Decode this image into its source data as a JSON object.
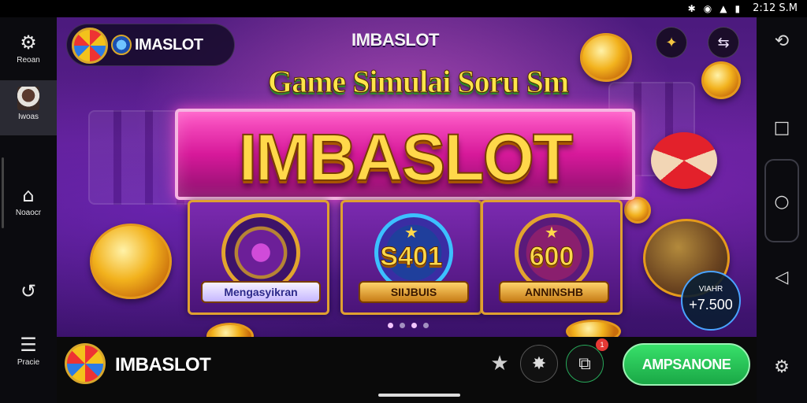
{
  "status_bar": {
    "icons": [
      "bluetooth-icon",
      "wifi-icon",
      "signal-icon",
      "battery-icon"
    ],
    "time": "2:12 S.M"
  },
  "left_rail": {
    "items": [
      {
        "label": "Reoan",
        "icon": "gear-icon"
      },
      {
        "label": "Iwoas",
        "icon": "avatar"
      },
      {
        "label": "Noaocr",
        "icon": "home-icon"
      },
      {
        "label": "",
        "icon": "undo-icon"
      },
      {
        "label": "Pracie",
        "icon": "layers-icon"
      }
    ]
  },
  "right_rail": {
    "icons": [
      "rotate-icon",
      "square-icon",
      "circle-home-icon",
      "back-triangle-icon",
      "settings-gear-icon"
    ]
  },
  "game": {
    "logo_text": "IMASLOT",
    "top_brand": "IMBASLOT",
    "subtitle": "Game Simulai Soru Sm",
    "banner_title": "IMBASLOT",
    "cards": [
      {
        "value": "",
        "ribbon": "Mengasyikran"
      },
      {
        "value": "S401",
        "ribbon": "SIIJBUIS"
      },
      {
        "value": "600",
        "ribbon": "ANNINSHB"
      }
    ],
    "counter": {
      "label": "VIAHR",
      "value": "+7.500"
    },
    "dots_count": 4,
    "accent_colors": {
      "banner": "#d7199a",
      "gold": "#ffd84a",
      "purple": "#4b1a7d"
    }
  },
  "bottom_bar": {
    "title": "IMBASLOT",
    "notification_count": "1",
    "install_label": "AMPSANONE"
  }
}
